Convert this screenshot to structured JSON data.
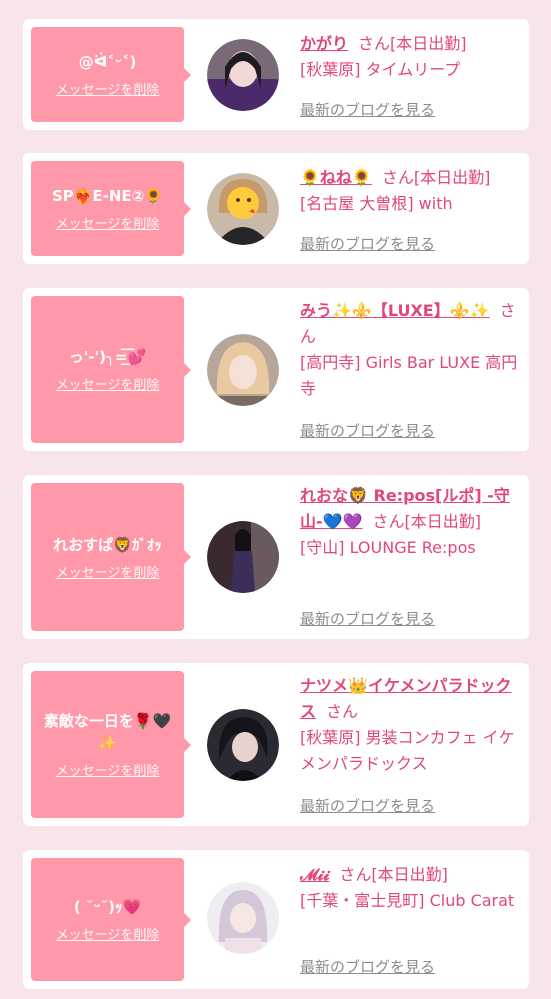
{
  "delete_label": "メッセージを削除",
  "blog_label": "最新のブログを見る",
  "san": "さん",
  "cards": [
    {
      "message": "@ᐛ˂ᵕ˂)",
      "name": "かがり",
      "status": "[本日出勤]",
      "shop": "[秋葉原] タイムリープ"
    },
    {
      "message": "SP❤️‍🔥E-NE②🌻",
      "name": "🌻ねね🌻",
      "status": "[本日出勤]",
      "shop": "[名古屋 大曽根] with"
    },
    {
      "message": "っ'-')╮=͟͟͞͞💕",
      "name": "みう✨⚜️【LUXE】⚜️✨",
      "status": "",
      "shop": "[高円寺] Girls Bar LUXE 高円寺"
    },
    {
      "message": "れおすぱ🦁ｶﾞｵｯ",
      "name": "れおな🦁 Re:pos[ルポ] -守山-💙💜",
      "status": "[本日出勤]",
      "shop": "[守山] LOUNGE Re:pos"
    },
    {
      "message": "素敵な一日を🌹🖤✨",
      "name": "ナツメ👑イケメンパラドックス",
      "status": "",
      "shop": "[秋葉原] 男装コンカフェ イケメンパラドックス"
    },
    {
      "message": "( ˘ᵕ˘)ｯ💗",
      "name": "𝓜𝓲𝓲",
      "status": "[本日出勤]",
      "shop": "[千葉・富士見町] Club Carat"
    }
  ],
  "colors": {
    "background": "#f7e5ea",
    "bubble": "#ff98a8",
    "name_text": "#e2477a",
    "link_gray": "#8c8c8c"
  }
}
